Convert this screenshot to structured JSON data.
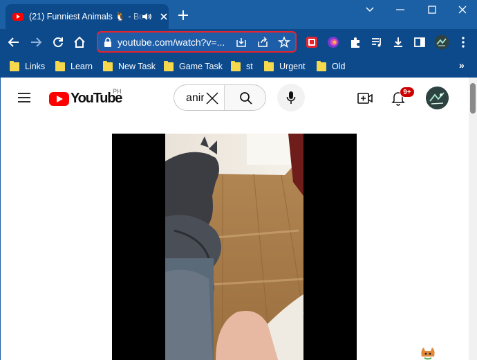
{
  "browser": {
    "tab_title": "(21) Funniest Animals 🐧 - Bo",
    "new_tab_label": "+",
    "url": "youtube.com/watch?v=...",
    "bookmarks": [
      "Links",
      "Learn",
      "New Task",
      "Game Task",
      "st",
      "Urgent",
      "Old"
    ],
    "bookmarks_more": "»"
  },
  "youtube": {
    "logo_text": "YouTube",
    "region": "PH",
    "search_value": "anir",
    "notification_count": "9+"
  },
  "colors": {
    "browser_frame": "#0c4a8c",
    "tab_strip": "#1b5fa5",
    "highlight": "#e8232e",
    "youtube_red": "#ff0000",
    "badge": "#cc0000"
  }
}
